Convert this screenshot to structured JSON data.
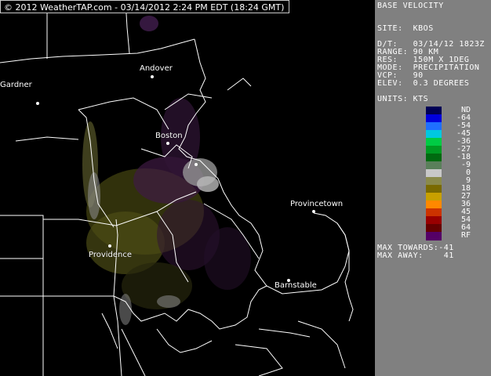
{
  "copyright": "© 2012 WeatherTAP.com - 03/14/2012  2:24 PM EDT (18:24 GMT)",
  "panel": {
    "product": "BASE VELOCITY",
    "site": "SITE:  KBOS",
    "dt": "D/T:   03/14/12 1823Z",
    "range": "RANGE: 90 KM",
    "res": "RES:   150M X 1DEG",
    "mode": "MODE:  PRECIPITATION",
    "vcp": "VCP:   90",
    "elev": "ELEV:  0.3 DEGREES",
    "units": "UNITS: KTS",
    "max_towards": "MAX TOWARDS:-41",
    "max_away": "MAX AWAY:    41"
  },
  "legend": {
    "labels": [
      "ND",
      "-64",
      "-54",
      "-45",
      "-36",
      "-27",
      "-18",
      "-9",
      "0",
      "9",
      "18",
      "27",
      "36",
      "45",
      "54",
      "64",
      "RF"
    ],
    "colors": [
      "#000055",
      "#0000dd",
      "#1f6fff",
      "#00c8e0",
      "#00cc44",
      "#009a22",
      "#006a10",
      "#5a7f5a",
      "#c8c8c8",
      "#8a8a4a",
      "#7a6a00",
      "#c8a000",
      "#ff8800",
      "#cc3300",
      "#990000",
      "#660000",
      "#550066"
    ]
  },
  "cities": [
    {
      "name": "Gardner"
    },
    {
      "name": "Andover"
    },
    {
      "name": "Boston"
    },
    {
      "name": "Provincetown"
    },
    {
      "name": "Providence"
    },
    {
      "name": "Barnstable"
    }
  ],
  "colors": {
    "background": "#000000",
    "panel": "#808080",
    "borders": "#ffffff",
    "echo_olive": "#8a8a2a",
    "echo_purple": "#7a2a8a"
  }
}
